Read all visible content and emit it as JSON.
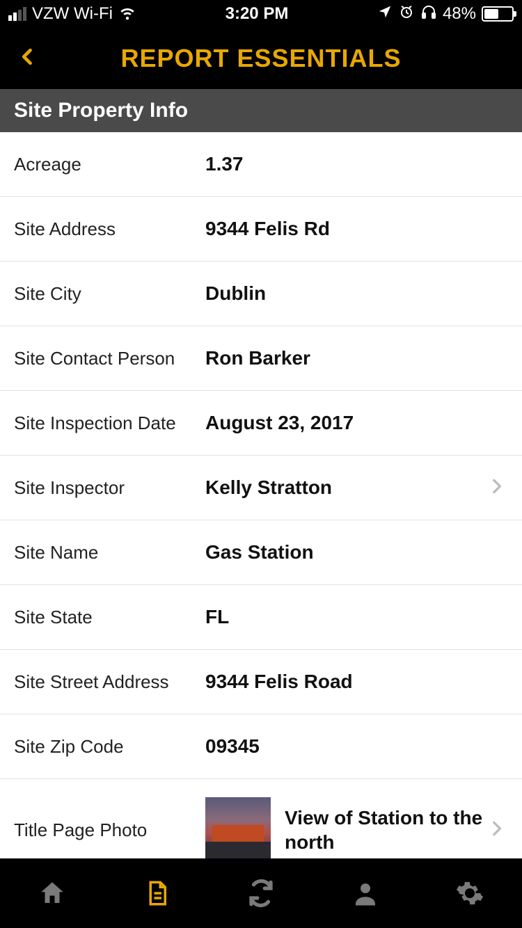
{
  "status_bar": {
    "carrier": "VZW Wi-Fi",
    "time": "3:20 PM",
    "battery_pct": "48%",
    "battery_level_width": "48%"
  },
  "header": {
    "title": "REPORT ESSENTIALS"
  },
  "section": {
    "title": "Site Property Info"
  },
  "rows": {
    "acreage": {
      "label": "Acreage",
      "value": "1.37"
    },
    "site_address": {
      "label": "Site Address",
      "value": "9344 Felis Rd"
    },
    "site_city": {
      "label": "Site City",
      "value": "Dublin"
    },
    "site_contact_person": {
      "label": "Site Contact Person",
      "value": "Ron Barker"
    },
    "site_inspection_date": {
      "label": "Site Inspection Date",
      "value": "August 23, 2017"
    },
    "site_inspector": {
      "label": "Site Inspector",
      "value": "Kelly Stratton"
    },
    "site_name": {
      "label": "Site Name",
      "value": "Gas Station"
    },
    "site_state": {
      "label": "Site State",
      "value": "FL"
    },
    "site_street_address": {
      "label": "Site Street Address",
      "value": "9344 Felis Road"
    },
    "site_zip_code": {
      "label": "Site Zip Code",
      "value": "09345"
    },
    "title_page_photo": {
      "label": "Title Page Photo",
      "value": "View of Station to the north"
    }
  },
  "colors": {
    "accent": "#e8a802"
  }
}
